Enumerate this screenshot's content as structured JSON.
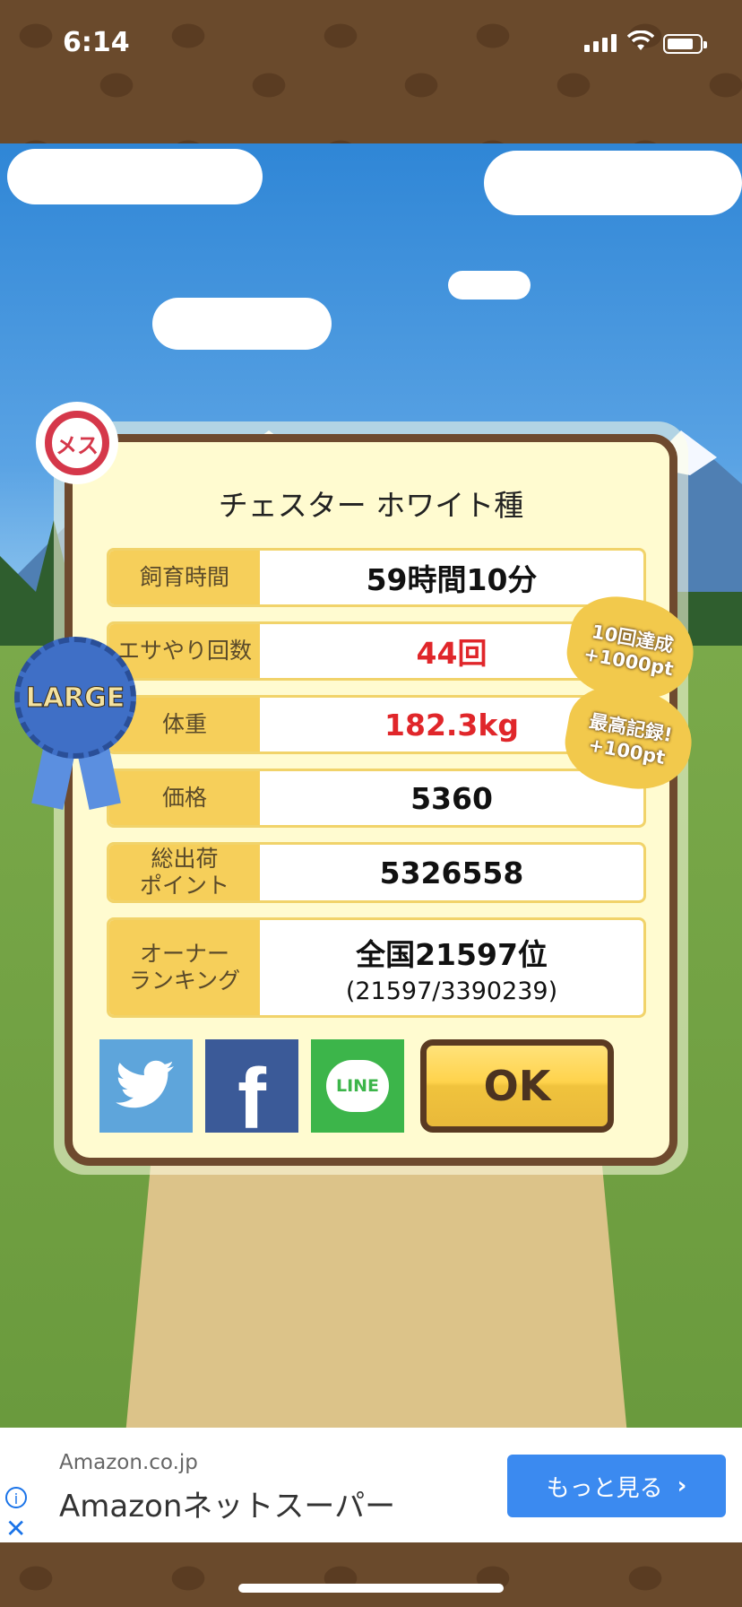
{
  "status": {
    "time": "6:14"
  },
  "badges": {
    "gender": "メス",
    "size": "LARGE"
  },
  "panel": {
    "title": "チェスター ホワイト種",
    "rows": [
      {
        "label": "飼育時間",
        "value": "59時間10分"
      },
      {
        "label": "エサやり回数",
        "value": "44回"
      },
      {
        "label": "体重",
        "value": "182.3kg"
      },
      {
        "label": "価格",
        "value": "5360"
      },
      {
        "label": "総出荷\nポイント",
        "value": "5326558"
      },
      {
        "label": "オーナー\nランキング",
        "value": "全国21597位",
        "sub": "(21597/3390239)"
      }
    ],
    "ok_label": "OK"
  },
  "bonuses": [
    {
      "line1": "10回達成",
      "line2": "+1000pt"
    },
    {
      "line1": "最高記録!",
      "line2": "+100pt"
    }
  ],
  "social": {
    "twitter": "twitter-icon",
    "facebook": "f",
    "line": "LINE"
  },
  "ad": {
    "domain": "Amazon.co.jp",
    "title": "Amazonネットスーパー",
    "button": "もっと見る"
  },
  "colors": {
    "panel_border": "#6e4a2e",
    "label_bg": "#f6cf5a",
    "accent_red": "#e0262a",
    "ad_button": "#3b8af0"
  }
}
